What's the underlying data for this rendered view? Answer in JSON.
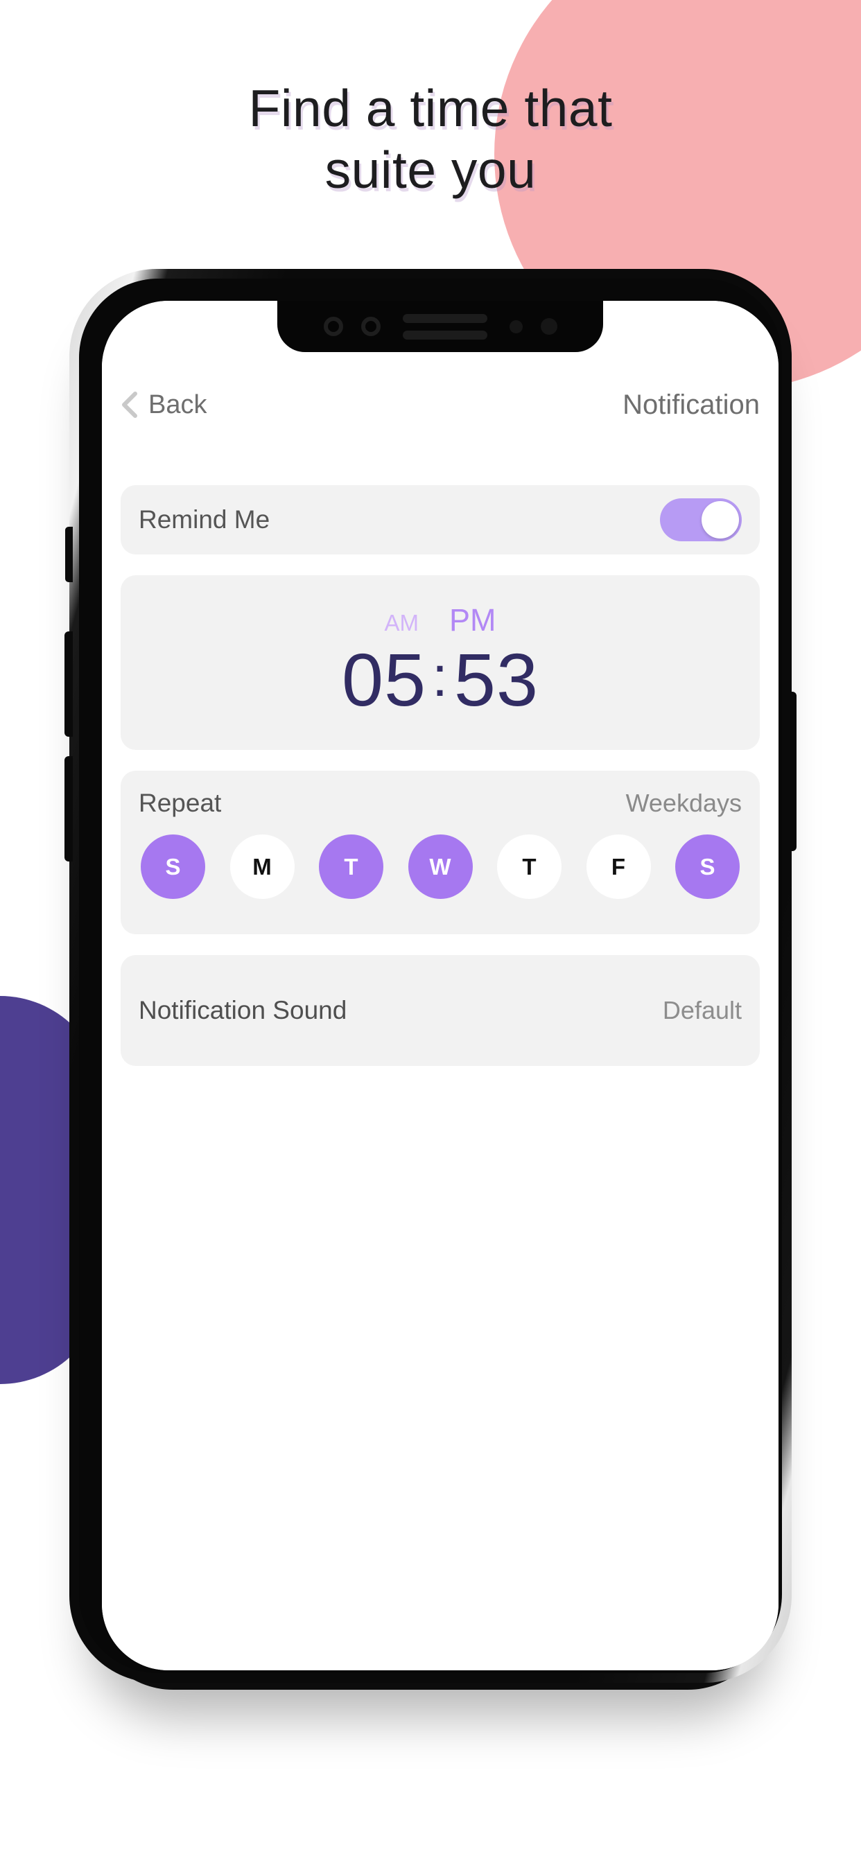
{
  "promo": {
    "headline": "Find a time that suite you"
  },
  "theme": {
    "accent_purple": "#a678f0",
    "toggle_on": "#b79bf4",
    "time_navy": "#312c63",
    "card_gray": "#f2f2f2",
    "bg_pink_circle": "#f7afb1",
    "bg_purple_shape": "#4e3f91"
  },
  "screen": {
    "nav": {
      "back_label": "Back",
      "back_icon": "chevron-left-icon",
      "title": "Notification"
    },
    "remind": {
      "label": "Remind Me",
      "toggle_state": "on"
    },
    "time": {
      "am_label": "AM",
      "pm_label": "PM",
      "selected_period": "PM",
      "hours": "05",
      "separator": ":",
      "minutes": "53"
    },
    "repeat": {
      "label": "Repeat",
      "value": "Weekdays",
      "days": [
        {
          "letter": "S",
          "selected": true
        },
        {
          "letter": "M",
          "selected": false
        },
        {
          "letter": "T",
          "selected": true
        },
        {
          "letter": "W",
          "selected": true
        },
        {
          "letter": "T",
          "selected": false
        },
        {
          "letter": "F",
          "selected": false
        },
        {
          "letter": "S",
          "selected": true
        }
      ]
    },
    "sound": {
      "label": "Notification Sound",
      "value": "Default"
    }
  }
}
